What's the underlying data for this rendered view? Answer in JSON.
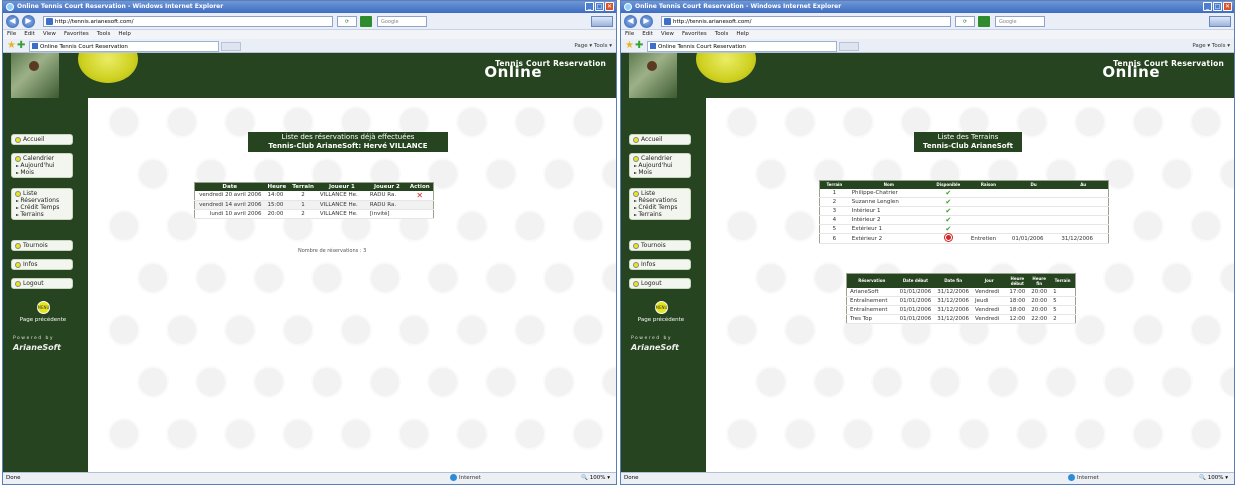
{
  "windows": [
    {
      "title": "Online Tennis Court Reservation - Windows Internet Explorer",
      "url": "http://tennis.arianesoft.com/",
      "search_placeholder": "Google",
      "menu": [
        "File",
        "Edit",
        "View",
        "Favorites",
        "Tools",
        "Help"
      ],
      "tab_label": "Online Tennis Court Reservation",
      "toolbar_right": "Page ▾ Tools ▾",
      "status_left": "Done",
      "status_zone": "Internet",
      "status_zoom": "100%",
      "banner": {
        "small": "Tennis Court Reservation",
        "big": "Online"
      },
      "nav": [
        {
          "title": "Accueil",
          "subs": []
        },
        {
          "title": "Calendrier",
          "subs": [
            "Aujourd'hui",
            "Mois"
          ]
        },
        {
          "title": "Liste",
          "subs": [
            "Réservations",
            "Crédit Temps",
            "Terrains"
          ]
        },
        {
          "title": "Tournois",
          "subs": []
        },
        {
          "title": "Infos",
          "subs": []
        },
        {
          "title": "Logout",
          "subs": []
        }
      ],
      "prev_page": {
        "circle": "MENU",
        "label": "Page précédente"
      },
      "powered": {
        "line": "Powered by",
        "logo": "ArianeSoft"
      },
      "heading": {
        "line1": "Liste des réservations déjà effectuées",
        "line2": "Tennis-Club ArianeSoft: Hervé VILLANCE"
      },
      "table": {
        "headers": [
          "Date",
          "Heure",
          "Terrain",
          "Joueur 1",
          "Joueur 2",
          "Action"
        ],
        "rows": [
          [
            "vendredi 20 avril 2006",
            "14:00",
            "2",
            "VILLANCE He.",
            "RADU Ra.",
            "✕"
          ],
          [
            "vendredi 14 avril 2006",
            "15:00",
            "1",
            "VILLANCE He.",
            "RADU Ra.",
            ""
          ],
          [
            "lundi 10 avril 2006",
            "20:00",
            "2",
            "VILLANCE He.",
            "[invité]",
            ""
          ]
        ]
      },
      "count_text": "Nombre de réservations : 3"
    },
    {
      "title": "Online Tennis Court Reservation - Windows Internet Explorer",
      "url": "http://tennis.arianesoft.com/",
      "search_placeholder": "Google",
      "menu": [
        "File",
        "Edit",
        "View",
        "Favorites",
        "Tools",
        "Help"
      ],
      "tab_label": "Online Tennis Court Reservation",
      "toolbar_right": "Page ▾ Tools ▾",
      "status_left": "Done",
      "status_zone": "Internet",
      "status_zoom": "100%",
      "banner": {
        "small": "Tennis Court Reservation",
        "big": "Online"
      },
      "nav": [
        {
          "title": "Accueil",
          "subs": []
        },
        {
          "title": "Calendrier",
          "subs": [
            "Aujourd'hui",
            "Mois"
          ]
        },
        {
          "title": "Liste",
          "subs": [
            "Réservations",
            "Crédit Temps",
            "Terrains"
          ]
        },
        {
          "title": "Tournois",
          "subs": []
        },
        {
          "title": "Infos",
          "subs": []
        },
        {
          "title": "Logout",
          "subs": []
        }
      ],
      "prev_page": {
        "circle": "MENU",
        "label": "Page précédente"
      },
      "powered": {
        "line": "Powered by",
        "logo": "ArianeSoft"
      },
      "heading": {
        "line1": "Liste des Terrains",
        "line2": "Tennis-Club ArianeSoft"
      },
      "courts_table": {
        "headers": [
          "Terrain",
          "Nom",
          "Disponible",
          "Raison",
          "Du",
          "Au"
        ],
        "rows": [
          [
            "1",
            "Philippe-Chatrier",
            "yes",
            "",
            "",
            ""
          ],
          [
            "2",
            "Suzanne Lenglen",
            "yes",
            "",
            "",
            ""
          ],
          [
            "3",
            "Intérieur 1",
            "yes",
            "",
            "",
            ""
          ],
          [
            "4",
            "Intérieur 2",
            "yes",
            "",
            "",
            ""
          ],
          [
            "5",
            "Extérieur 1",
            "yes",
            "",
            "",
            ""
          ],
          [
            "6",
            "Extérieur 2",
            "no",
            "Entretien",
            "01/01/2006",
            "31/12/2006"
          ]
        ]
      },
      "reservations_table": {
        "headers": [
          "Réservation",
          "Date début",
          "Date fin",
          "Jour",
          "Heure début",
          "Heure fin",
          "Terrain"
        ],
        "rows": [
          [
            "ArianeSoft",
            "01/01/2006",
            "31/12/2006",
            "Vendredi",
            "17:00",
            "20:00",
            "1"
          ],
          [
            "Entraînement",
            "01/01/2006",
            "31/12/2006",
            "Jeudi",
            "18:00",
            "20:00",
            "5"
          ],
          [
            "Entraînement",
            "01/01/2006",
            "31/12/2006",
            "Vendredi",
            "18:00",
            "20:00",
            "5"
          ],
          [
            "Tres Top",
            "01/01/2006",
            "31/12/2006",
            "Vendredi",
            "12:00",
            "22:00",
            "2"
          ]
        ]
      }
    }
  ],
  "colors": {
    "brand_green": "#26441f",
    "accent_yellow": "#e6e61a",
    "ie_blue": "#3e6cc2"
  }
}
